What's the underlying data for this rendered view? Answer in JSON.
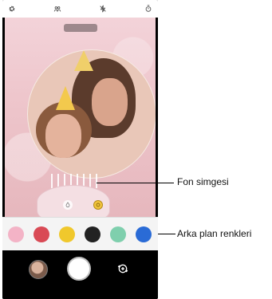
{
  "callouts": {
    "background_icon": "Fon simgesi",
    "background_colors": "Arka plan renkleri"
  },
  "status_icons": [
    "gear-icon",
    "people-icon",
    "no-flash-icon",
    "timer-icon"
  ],
  "swatches": [
    {
      "name": "pink",
      "color": "#f3b3c6"
    },
    {
      "name": "red",
      "color": "#d94a55"
    },
    {
      "name": "yellow",
      "color": "#f0c82c"
    },
    {
      "name": "black",
      "color": "#222222"
    },
    {
      "name": "mint",
      "color": "#7fcfad"
    },
    {
      "name": "blue",
      "color": "#2a6bd6"
    }
  ]
}
